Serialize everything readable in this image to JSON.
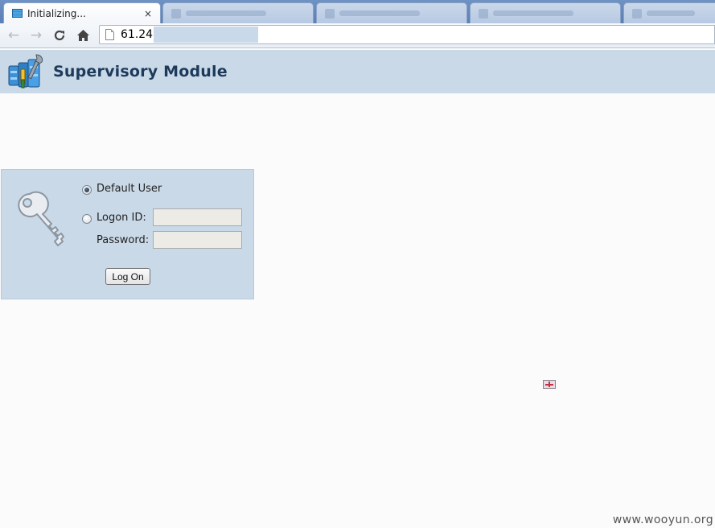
{
  "browser": {
    "active_tab": {
      "title": "Initializing...",
      "close": "×"
    },
    "address": {
      "url_visible": "61.24"
    }
  },
  "header": {
    "title": "Supervisory Module"
  },
  "login": {
    "default_user_label": "Default User",
    "logon_id_label": "Logon ID:",
    "password_label": "Password:",
    "logon_id_value": "",
    "password_value": "",
    "submit_label": "Log On",
    "selected_option": "Default User"
  },
  "watermark": "www.wooyun.org",
  "colors": {
    "header_bg": "#c9d9e8",
    "title_text": "#1d3a5a",
    "page_bg": "#fbfbfb",
    "tabstrip": "#5a7fb6"
  }
}
